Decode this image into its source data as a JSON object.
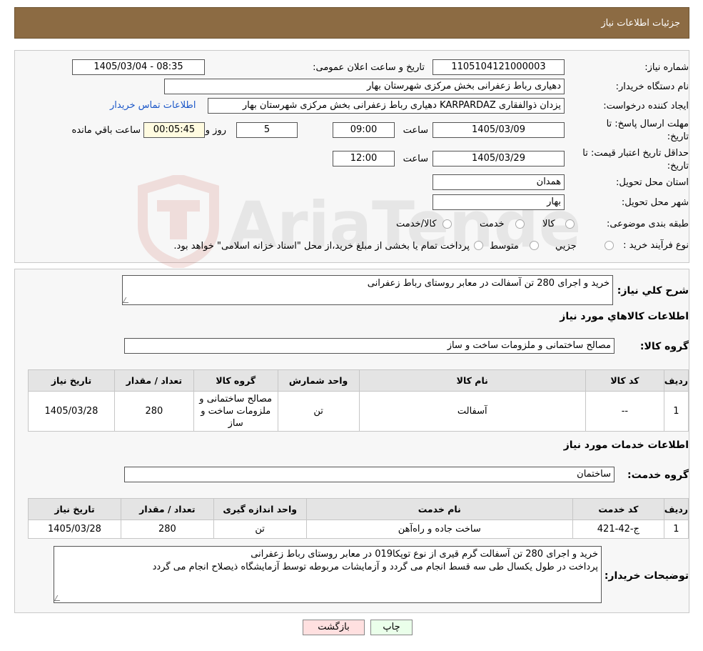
{
  "page": {
    "title": "جزئیات اطلاعات نیاز"
  },
  "form": {
    "need_number_label": "شماره نیاز:",
    "need_number": "1105104121000003",
    "announce_label": "تاریخ و ساعت اعلان عمومی:",
    "announce_value": "1405/03/04 - 08:35",
    "buyer_org_label": "نام دستگاه خریدار:",
    "buyer_org": "دهیاری رباط زعفرانی بخش مرکزی شهرستان بهار",
    "creator_label": "ایجاد کننده درخواست:",
    "creator": "یزدان ذوالفقاری KARPARDAZ دهیاری رباط زعفرانی بخش مرکزی شهرستان بهار",
    "contact_link": "اطلاعات تماس خریدار",
    "deadline_label_1": "مهلت ارسال پاسخ: تا",
    "deadline_label_2": "تاریخ:",
    "deadline_date": "1405/03/09",
    "time_label": "ساعت",
    "deadline_time": "09:00",
    "days_value": "5",
    "days_label": "روز و",
    "remaining_time": "00:05:45",
    "remaining_label": "ساعت باقي مانده",
    "validity_label_1": "حداقل تاریخ اعتبار قیمت: تا",
    "validity_label_2": "تاریخ:",
    "validity_date": "1405/03/29",
    "validity_time": "12:00",
    "province_label": "استان محل تحویل:",
    "province": "همدان",
    "city_label": "شهر محل تحویل:",
    "city": "بهار",
    "category_label": "طبقه بندی موضوعی:",
    "category_options": [
      "کالا",
      "خدمت",
      "کالا/خدمت"
    ],
    "process_label": "نوع فرآیند خرید :",
    "process_options": [
      "جزیي",
      "متوسط"
    ],
    "process_note": "پرداخت تمام یا بخشی از مبلغ خرید،از محل \"اسناد خزانه اسلامی\" خواهد بود."
  },
  "summary": {
    "label": "شرح کلي نیاز:",
    "text": "خرید و اجرای 280 تن آسفالت در معابر روستای رباط زعفرانی"
  },
  "goods": {
    "section_title": "اطلاعات کالاهاي مورد نياز",
    "group_label": "گروه کالا:",
    "group_value": "مصالح ساختمانی و ملزومات ساخت و ساز",
    "headers": [
      "رديف",
      "کد کالا",
      "نام کالا",
      "واحد شمارش",
      "گروه کالا",
      "تعداد / مقدار",
      "تاريخ نياز"
    ],
    "rows": [
      {
        "idx": "1",
        "code": "--",
        "name": "آسفالت",
        "unit": "تن",
        "group": "مصالح ساختمانی و ملزومات ساخت و ساز",
        "qty": "280",
        "date": "1405/03/28"
      }
    ]
  },
  "services": {
    "section_title": "اطلاعات خدمات مورد نیاز",
    "group_label": "گروه خدمت:",
    "group_value": "ساختمان",
    "headers": [
      "رديف",
      "کد خدمت",
      "نام خدمت",
      "واحد اندازه گیری",
      "تعداد / مقدار",
      "تاريخ نياز"
    ],
    "rows": [
      {
        "idx": "1",
        "code": "ج-42-421",
        "name": "ساخت جاده و راه‌آهن",
        "unit": "تن",
        "qty": "280",
        "date": "1405/03/28"
      }
    ]
  },
  "buyer_notes": {
    "label": "توضیحات خریدار:",
    "line1": "خرید و اجرای 280 تن آسفالت گرم قیری از نوع توپکا019 در معابر روستای رباط زعفرانی",
    "line2": "پرداخت در طول یکسال طی سه قسط انجام می گردد و آزمایشات مربوطه توسط آزمایشگاه ذیصلاح انجام می گردد"
  },
  "buttons": {
    "print": "چاپ",
    "back": "بازگشت"
  },
  "watermark": {
    "text": "AriaTender.neT"
  },
  "colors": {
    "header_bg": "#8c6b43",
    "link": "#1a56c8",
    "print_bg": "#eaffea",
    "back_bg": "#ffe0e0"
  },
  "icons": [
    "shield-logo-icon",
    "resize-grip-icon",
    "radio-icon"
  ]
}
